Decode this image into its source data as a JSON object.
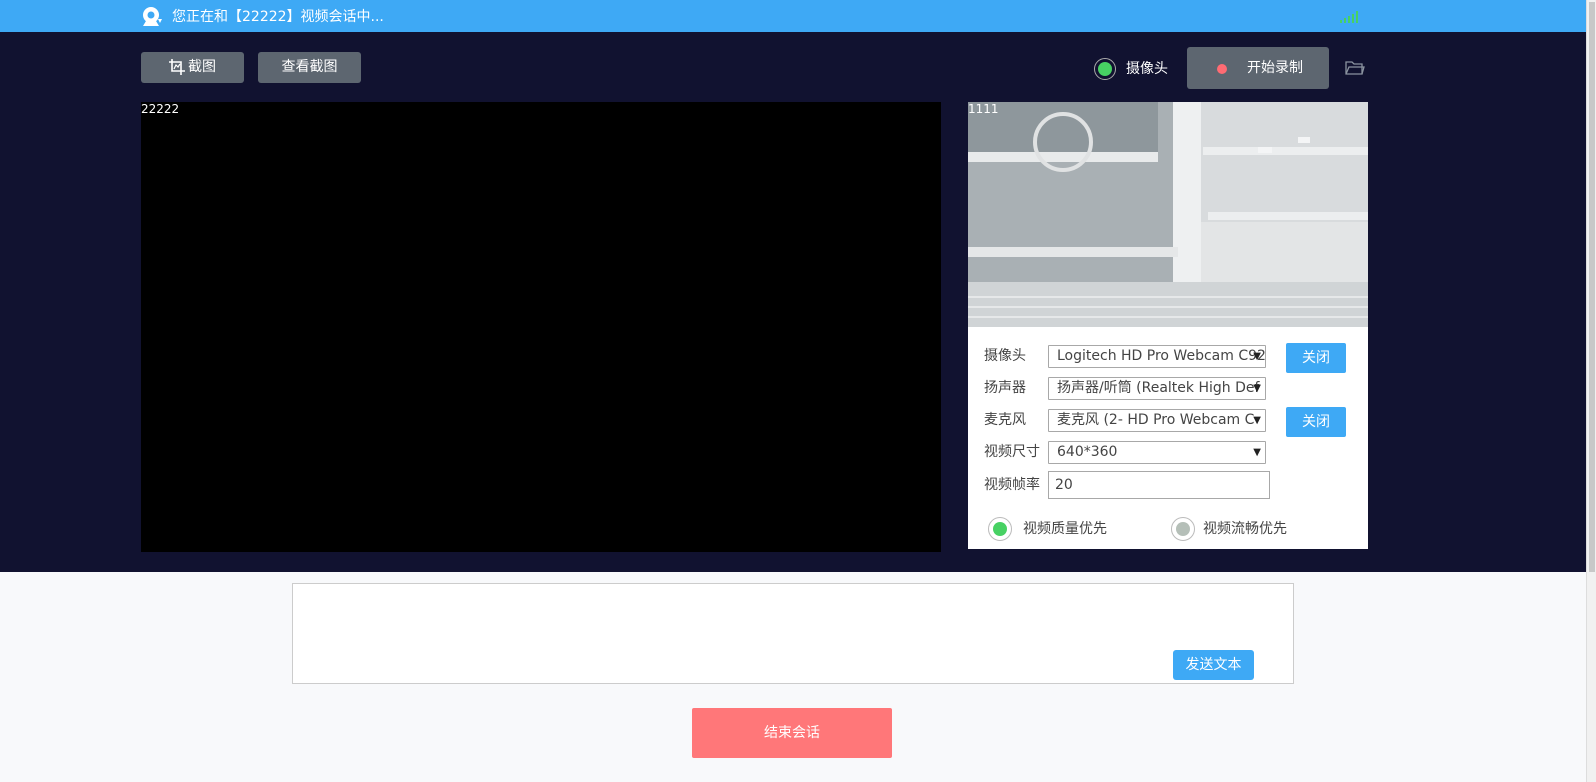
{
  "header": {
    "title": "您正在和【22222】视频会话中...",
    "logo_icon": "webcam-icon",
    "signal_icon": "signal-bars-icon",
    "signal_color": "#47d163"
  },
  "toolbar": {
    "screenshot_label": "截图",
    "screenshot_icon": "crop-icon",
    "view_screenshots_label": "查看截图",
    "camera_toggle_label": "摄像头",
    "record_label": "开始录制",
    "folder_icon": "folder-icon"
  },
  "video": {
    "remote_label": "22222",
    "local_label": "1111"
  },
  "settings": {
    "camera": {
      "label": "摄像头",
      "value": "Logitech HD Pro Webcam C92",
      "button": "关闭"
    },
    "speaker": {
      "label": "扬声器",
      "value": "扬声器/听筒 (Realtek High Def"
    },
    "mic": {
      "label": "麦克风",
      "value": "麦克风 (2- HD Pro Webcam C",
      "button": "关闭"
    },
    "video_size": {
      "label": "视频尺寸",
      "value": "640*360"
    },
    "frame_rate": {
      "label": "视频帧率",
      "value": "20"
    },
    "quality_priority": {
      "label": "视频质量优先",
      "selected": true
    },
    "fluency_priority": {
      "label": "视频流畅优先",
      "selected": false
    }
  },
  "chat": {
    "text": "",
    "send_label": "发送文本"
  },
  "end_call_label": "结束会话",
  "colors": {
    "accent": "#3ea9f5",
    "dark_bg": "#111230",
    "end_button": "#ff7779",
    "active_green": "#47d163",
    "inactive_gray": "#b5bfb8"
  }
}
